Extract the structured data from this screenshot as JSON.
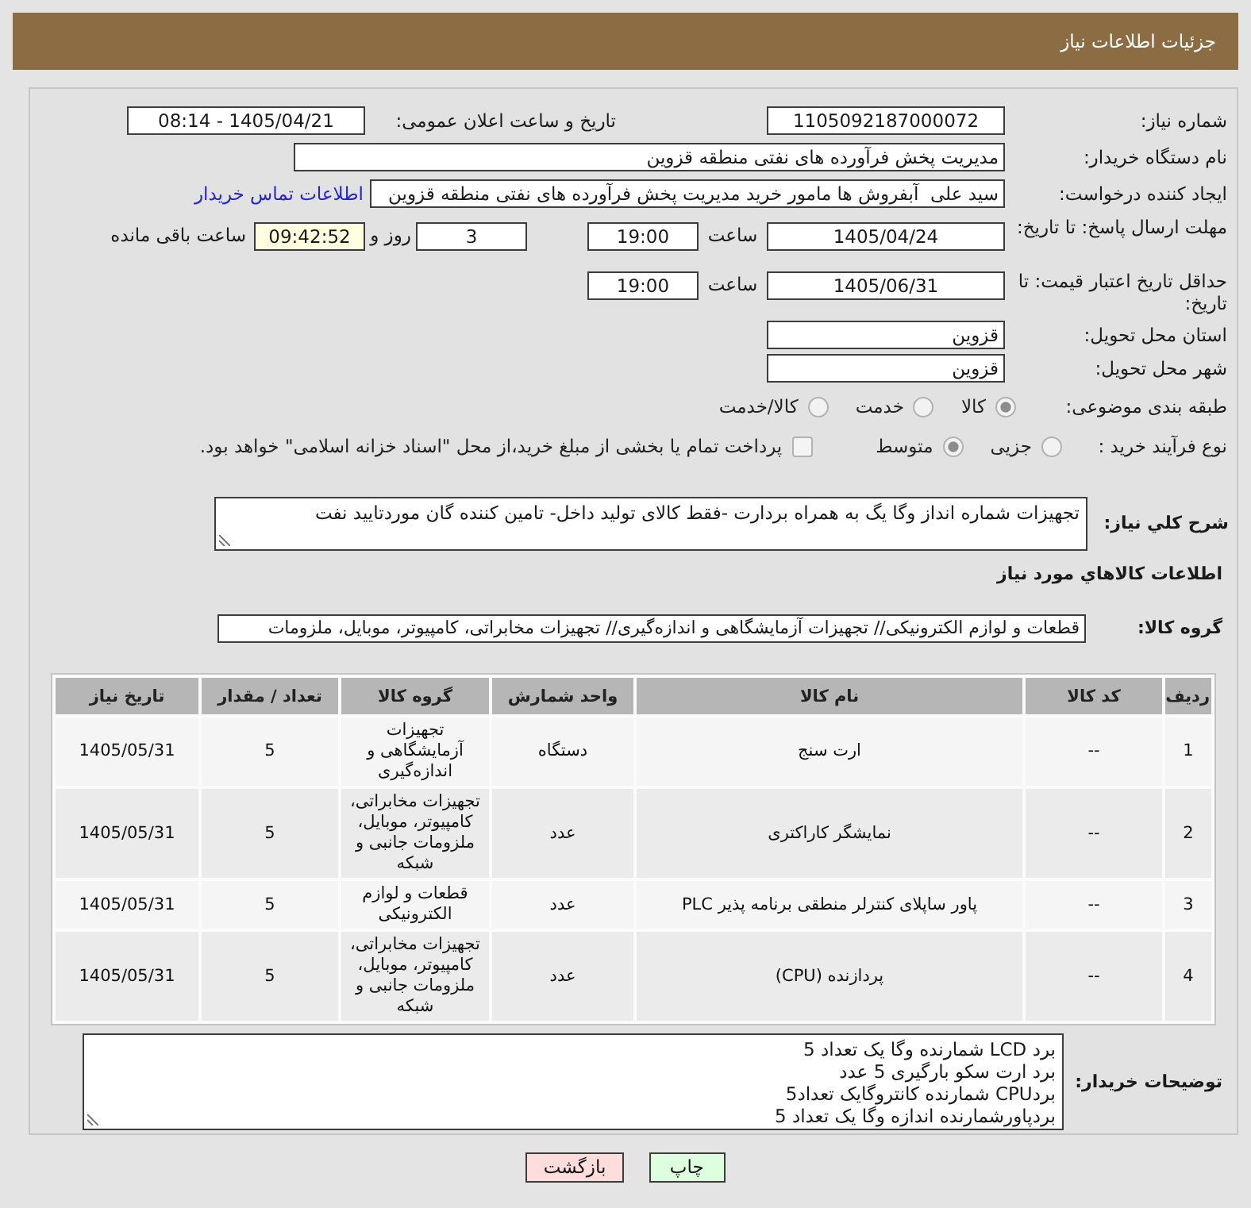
{
  "header": {
    "title": "جزئیات اطلاعات نیاز"
  },
  "need": {
    "label": "شماره نیاز:",
    "value": "1105092187000072",
    "announce_label": "تاریخ و ساعت اعلان عمومی:",
    "announce_value": "1405/04/21 - 08:14"
  },
  "buyer": {
    "label": "نام دستگاه خریدار:",
    "value": "مدیریت پخش فرآورده های نفتی منطقه قزوین"
  },
  "requester": {
    "label": "ایجاد کننده درخواست:",
    "value": "سید علی  آبفروش ها مامور خرید مدیریت پخش فرآورده های نفتی منطقه قزوین",
    "contact_link": "اطلاعات تماس خریدار"
  },
  "reply_deadline": {
    "label": "مهلت ارسال پاسخ: تا تاریخ:",
    "date": "1405/04/24",
    "time_label": "ساعت",
    "time": "19:00",
    "days": "3",
    "days_label": "روز و",
    "remaining": "09:42:52",
    "remaining_label": "ساعت باقی مانده"
  },
  "price_validity": {
    "label": "حداقل تاریخ اعتبار قیمت: تا تاریخ:",
    "date": "1405/06/31",
    "time_label": "ساعت",
    "time": "19:00"
  },
  "delivery_province": {
    "label": "استان محل تحویل:",
    "value": "قزوین"
  },
  "delivery_city": {
    "label": "شهر محل تحویل:",
    "value": "قزوین"
  },
  "subject_category": {
    "label": "طبقه بندی موضوعی:",
    "options": [
      {
        "label": "کالا",
        "selected": true
      },
      {
        "label": "خدمت",
        "selected": false
      },
      {
        "label": "کالا/خدمت",
        "selected": false
      }
    ]
  },
  "purchase_process": {
    "label": "نوع فرآیند خرید :",
    "options": [
      {
        "label": "جزیی",
        "selected": false
      },
      {
        "label": "متوسط",
        "selected": true
      }
    ],
    "treasury_payment": {
      "label": "پرداخت تمام یا بخشی از مبلغ خرید،از محل \"اسناد خزانه اسلامی\" خواهد بود.",
      "checked": false
    }
  },
  "description": {
    "label": "شرح کلي نياز:",
    "text": "تجهیزات شماره انداز وگا یگ به همراه بردارت -فقط کالای تولید داخل- تامین کننده گان موردتایید نفت"
  },
  "goods": {
    "title": "اطلاعات کالاهاي مورد نياز",
    "group_label": "گروه کالا:",
    "group_value": "قطعات و لوازم الکترونیکی// تجهیزات آزمایشگاهی و اندازه‌گیری// تجهیزات مخابراتی، کامپیوتر، موبایل، ملزومات"
  },
  "table": {
    "columns": [
      "ردیف",
      "کد کالا",
      "نام کالا",
      "واحد شمارش",
      "گروه کالا",
      "تعداد / مقدار",
      "تاریخ نیاز"
    ],
    "rows": [
      {
        "row_number": "1",
        "item_code": "--",
        "item_name": "ارت سنج",
        "unit": "دستگاه",
        "item_group": "تجهیزات آزمایشگاهی و اندازه‌گیری",
        "quantity": "5",
        "need_date": "1405/05/31"
      },
      {
        "row_number": "2",
        "item_code": "--",
        "item_name": "نمایشگر کاراکتری",
        "unit": "عدد",
        "item_group": "تجهیزات مخابراتی، کامپیوتر، موبایل، ملزومات جانبی و شبکه",
        "quantity": "5",
        "need_date": "1405/05/31"
      },
      {
        "row_number": "3",
        "item_code": "--",
        "item_name": "پاور ساپلای کنترلر منطقی برنامه پذیر PLC",
        "unit": "عدد",
        "item_group": "قطعات و لوازم الکترونیکی",
        "quantity": "5",
        "need_date": "1405/05/31"
      },
      {
        "row_number": "4",
        "item_code": "--",
        "item_name": "پردازنده (CPU)",
        "unit": "عدد",
        "item_group": "تجهیزات مخابراتی، کامپیوتر، موبایل، ملزومات جانبی و شبکه",
        "quantity": "5",
        "need_date": "1405/05/31"
      }
    ]
  },
  "buyer_notes": {
    "label": "توضیحات خریدار:",
    "lines": [
      "برد LCD شمارنده وگا یک تعداد 5",
      "برد ارت سکو بارگیری 5 عدد",
      "بردCPU شمارنده کانتروگایک تعداد5",
      "بردپاورشمارنده اندازه وگا یک تعداد 5"
    ]
  },
  "buttons": [
    {
      "label": "چاپ",
      "color": "#ddffdd"
    },
    {
      "label": "بازگشت",
      "color": "#ffdddd"
    }
  ]
}
